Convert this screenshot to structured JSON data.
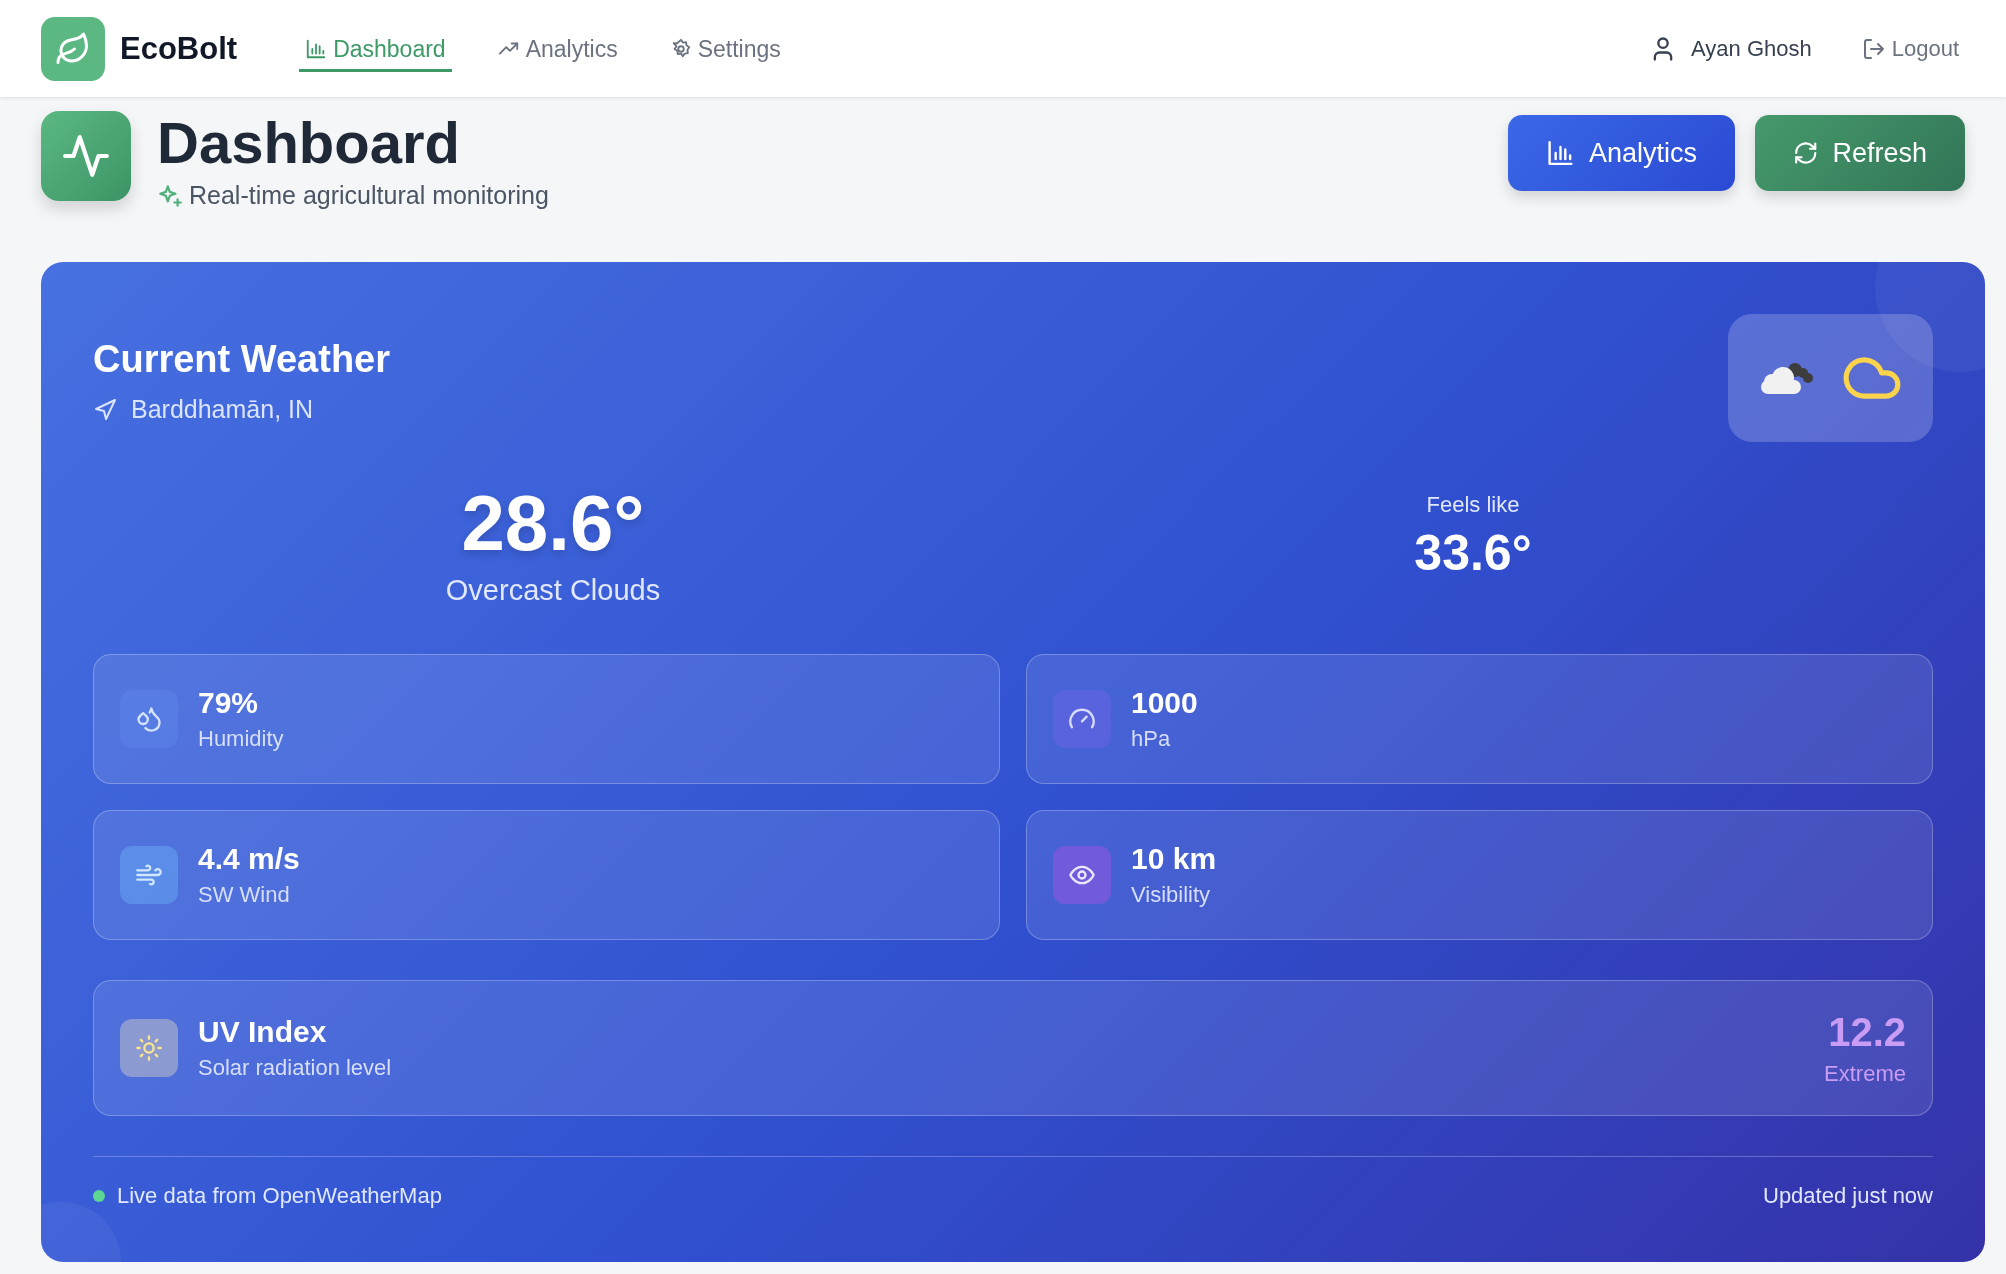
{
  "brand": {
    "name": "EcoBolt"
  },
  "nav": [
    {
      "label": "Dashboard",
      "kind": "chart",
      "selected": true
    },
    {
      "label": "Analytics",
      "kind": "trend",
      "selected": false
    },
    {
      "label": "Settings",
      "kind": "gear",
      "selected": false
    }
  ],
  "user": {
    "name": "Ayan Ghosh",
    "logout": "Logout"
  },
  "page": {
    "title": "Dashboard",
    "subtitle": "Real-time agricultural monitoring"
  },
  "actions": [
    {
      "label": "Analytics",
      "kind": "analytics"
    },
    {
      "label": "Refresh",
      "kind": "refresh"
    }
  ],
  "weather": {
    "title": "Current Weather",
    "location": "Barddhamān, IN",
    "temperature": "28.6°",
    "condition": "Overcast Clouds",
    "feels_like_label": "Feels like",
    "feels_like": "33.6°",
    "stats": [
      {
        "kind": "humidity",
        "value": "79%",
        "label": "Humidity"
      },
      {
        "kind": "pressure",
        "value": "1000",
        "label": "hPa"
      },
      {
        "kind": "wind",
        "value": "4.4 m/s",
        "label": "SW Wind"
      },
      {
        "kind": "visibility",
        "value": "10 km",
        "label": "Visibility"
      }
    ],
    "uv": {
      "title": "UV Index",
      "subtitle": "Solar radiation level",
      "value": "12.2",
      "level_label": "Extreme"
    },
    "footer": {
      "source": "Live data from OpenWeatherMap",
      "updated": "Updated just now"
    }
  }
}
